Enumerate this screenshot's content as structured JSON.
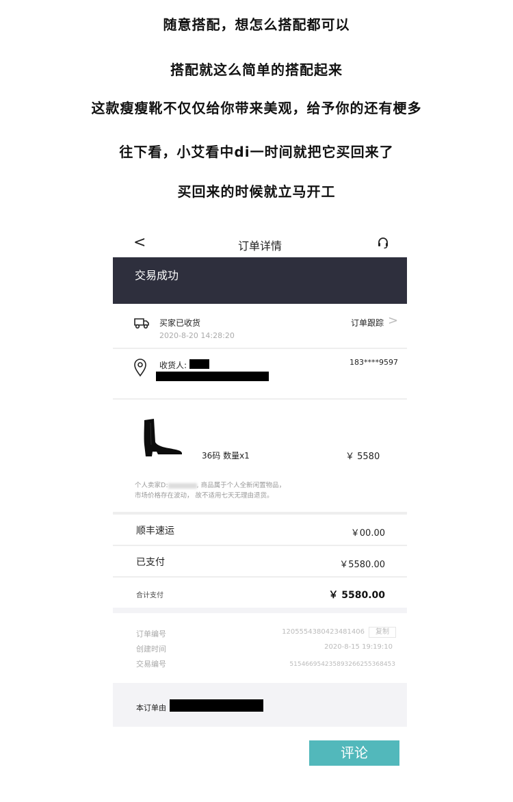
{
  "captions": [
    "随意搭配，想怎么搭配都可以",
    "搭配就这么简单的搭配起来",
    "这款瘦瘦靴不仅仅给你带来美观，给予你的还有梗多",
    "往下看，小艾看中di一时间就把它买回来了",
    "买回来的时候就立马开工"
  ],
  "nav": {
    "back_glyph": "<",
    "title": "订单详情",
    "support_icon": "headset-icon"
  },
  "status": {
    "text": "交易成功",
    "bg_color": "#2e2f3d"
  },
  "delivery": {
    "icon": "truck-icon",
    "title": "买家已收货",
    "time": "2020-8-20  14:28:20",
    "track_label": "订单跟踪",
    "chevron": ">"
  },
  "address": {
    "icon": "location-pin-icon",
    "receiver_label": "收货人:",
    "phone": "183****9597"
  },
  "product": {
    "image": "black-ankle-boot",
    "spec": "36码   数量x1",
    "price": "￥ 5580",
    "notice_prefix": "个人卖家D:",
    "notice_middle": ", 商品属于个人全新闲置物品，",
    "notice_line2": "市场价格存在波动， 故不适用七天无理由退货。"
  },
  "fees": [
    {
      "label": "顺丰速运",
      "value": "￥00.00"
    },
    {
      "label": "已支付",
      "value": "￥5580.00"
    }
  ],
  "total": {
    "label": "合计支付",
    "value": "￥ 5580.00"
  },
  "info": {
    "rows": [
      {
        "label": "订单编号",
        "value": "1205554380423481406"
      },
      {
        "label": "创建时间",
        "value": "2020-8-15  19:19:10"
      },
      {
        "label": "交易编号",
        "value": "515466954235893266255368453"
      }
    ],
    "copy_label": "复制"
  },
  "order_by": {
    "label": "本订单由"
  },
  "review_button": {
    "label": "评论",
    "color": "#52b8bb"
  }
}
